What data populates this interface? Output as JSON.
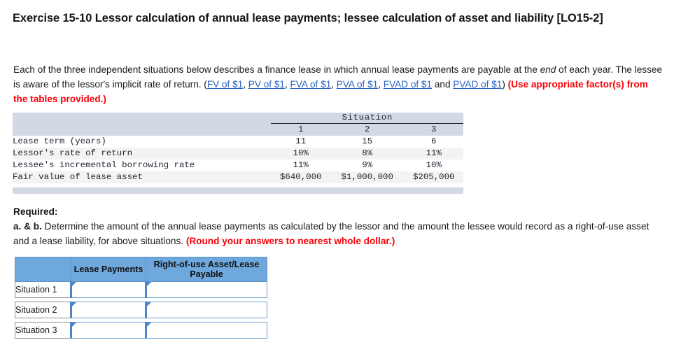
{
  "title": "Exercise 15-10 Lessor calculation of annual lease payments; lessee calculation of asset and liability [LO15-2]",
  "intro": {
    "part1": "Each of the three independent situations below describes a finance lease in which annual lease payments are payable at the ",
    "italic_word": "end",
    "part2": " of each year. The lessee is aware of the lessor's implicit rate of return. (",
    "links": [
      "FV of $1",
      "PV of $1",
      "FVA of $1",
      "PVA of $1",
      "FVAD of $1",
      "PVAD of $1"
    ],
    "sep_comma": ", ",
    "sep_and": " and ",
    "close_paren": ")",
    "note": " (Use appropriate factor(s) from the tables provided.)"
  },
  "situation_table": {
    "group_header": "Situation",
    "columns": [
      "1",
      "2",
      "3"
    ],
    "rows": [
      {
        "label": "Lease term (years)",
        "values": [
          "11",
          "15",
          "6"
        ]
      },
      {
        "label": "Lessor's rate of return",
        "values": [
          "10%",
          "8%",
          "11%"
        ]
      },
      {
        "label": "Lessee's incremental borrowing rate",
        "values": [
          "11%",
          "9%",
          "10%"
        ]
      },
      {
        "label": "Fair value of lease asset",
        "values": [
          "$640,000",
          "$1,000,000",
          "$205,000"
        ]
      }
    ]
  },
  "required": {
    "heading": "Required:",
    "ab_label": "a. & b.",
    "body1": " Determine the amount of the annual lease payments as calculated by the lessor and the amount the lessee would record as a right-of-use asset and a lease liability, for above situations. ",
    "round_note": "(Round your answers to nearest whole dollar.)"
  },
  "answer_table": {
    "corner": "",
    "col_lease_payments": "Lease Payments",
    "col_rou": "Right-of-use Asset/Lease Payable",
    "rows": [
      {
        "label": "Situation 1",
        "lease_payments": "",
        "rou": ""
      },
      {
        "label": "Situation 2",
        "lease_payments": "",
        "rou": ""
      },
      {
        "label": "Situation 3",
        "lease_payments": "",
        "rou": ""
      }
    ]
  },
  "colors": {
    "link_blue": "#2C63C4",
    "alert_red": "#FB0007",
    "header_blue": "#6FA8DC",
    "band_gray": "#d3d9e4",
    "input_border_blue": "#4a86c8"
  }
}
